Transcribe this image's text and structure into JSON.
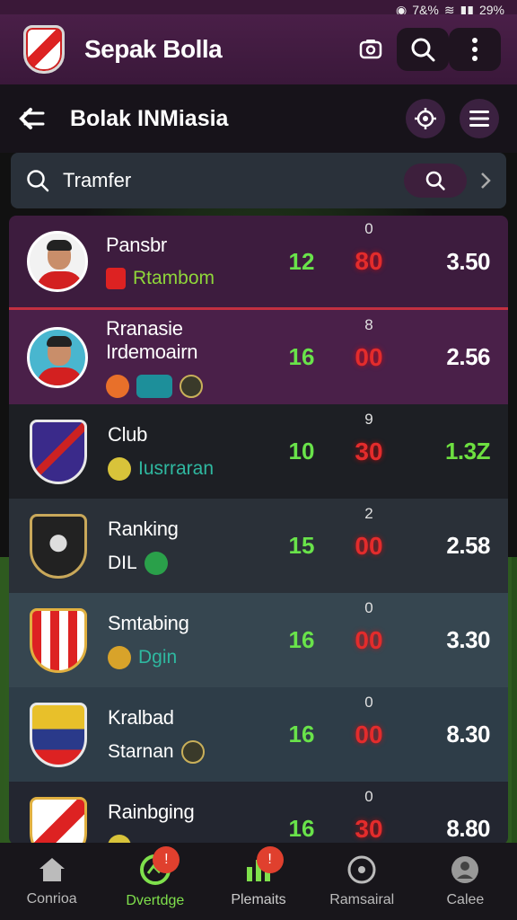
{
  "status": {
    "battery": "29%",
    "signal_text": "7&%"
  },
  "header": {
    "title": "Sepak Bolla"
  },
  "subheader": {
    "title": "Bolak INMiasia"
  },
  "search": {
    "value": "Tramfer",
    "placeholder": "Tramfer"
  },
  "rows": [
    {
      "name": "Pansbr",
      "sub_text": "Rtambom",
      "stat": "12",
      "top": "0",
      "score": "80",
      "odd": "3.50",
      "odd_green": false
    },
    {
      "name": "Rranasie Irdemoairn",
      "sub_text": "",
      "stat": "16",
      "top": "8",
      "score": "00",
      "odd": "2.56",
      "odd_green": false
    },
    {
      "name": "Club",
      "sub_text": "Iusrraran",
      "stat": "10",
      "top": "9",
      "score": "30",
      "odd": "1.3Z",
      "odd_green": true
    },
    {
      "name": "Ranking",
      "sub_text": "DIL",
      "stat": "15",
      "top": "2",
      "score": "00",
      "odd": "2.58",
      "odd_green": false
    },
    {
      "name": "Smtabing",
      "sub_text": "Dgin",
      "stat": "16",
      "top": "0",
      "score": "00",
      "odd": "3.30",
      "odd_green": false
    },
    {
      "name": "Kralbad",
      "sub_text": "Starnan",
      "stat": "16",
      "top": "0",
      "score": "00",
      "odd": "8.30",
      "odd_green": false
    },
    {
      "name": "Rainbging",
      "sub_text": "",
      "stat": "16",
      "top": "0",
      "score": "30",
      "odd": "8.80",
      "odd_green": false
    }
  ],
  "nav": [
    {
      "label": "Conrioa",
      "icon": "home-icon"
    },
    {
      "label": "Dvertdge",
      "icon": "ball-icon",
      "badge": "!"
    },
    {
      "label": "Plemaits",
      "icon": "chart-icon",
      "badge": "!"
    },
    {
      "label": "Ramsairal",
      "icon": "ball-outline-icon"
    },
    {
      "label": "Calee",
      "icon": "user-icon"
    }
  ],
  "colors": {
    "accent": "#6de040",
    "score": "#e32c2c",
    "header": "#3a183a"
  }
}
